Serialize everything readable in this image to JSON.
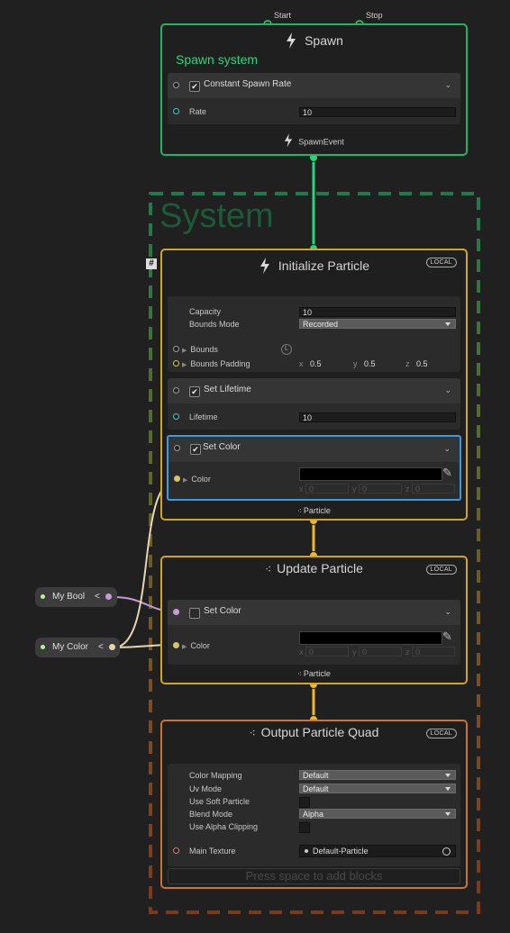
{
  "spawn": {
    "start_label": "Start",
    "stop_label": "Stop",
    "title": "Spawn",
    "subtitle": "Spawn system",
    "block_title": "Constant Spawn Rate",
    "rate_label": "Rate",
    "rate_value": "10",
    "event_label": "SpawnEvent",
    "accent": "#1fb565"
  },
  "system": {
    "title": "System"
  },
  "init": {
    "title": "Initialize Particle",
    "badge": "LOCAL",
    "hash": "#",
    "capacity_label": "Capacity",
    "capacity_value": "10",
    "bounds_mode_label": "Bounds Mode",
    "bounds_mode_value": "Recorded",
    "bounds_label": "Bounds",
    "bounds_badge": "L",
    "bounds_padding_label": "Bounds Padding",
    "padding": {
      "x_label": "x",
      "x": "0.5",
      "y_label": "y",
      "y": "0.5",
      "z_label": "z",
      "z": "0.5"
    },
    "set_lifetime_title": "Set Lifetime",
    "lifetime_label": "Lifetime",
    "lifetime_value": "10",
    "set_color_title": "Set Color",
    "color_label": "Color",
    "color": {
      "x_label": "x",
      "x": "0",
      "y_label": "y",
      "y": "0",
      "z_label": "z",
      "z": "0"
    },
    "flow_label": "Particle"
  },
  "update": {
    "title": "Update Particle",
    "badge": "LOCAL",
    "set_color_title": "Set Color",
    "color_label": "Color",
    "color": {
      "x_label": "x",
      "x": "0",
      "y_label": "y",
      "y": "0",
      "z_label": "z",
      "z": "0"
    },
    "flow_label": "Particle"
  },
  "output": {
    "title": "Output Particle Quad",
    "badge": "LOCAL",
    "color_mapping_label": "Color Mapping",
    "color_mapping_value": "Default",
    "uv_mode_label": "Uv Mode",
    "uv_mode_value": "Default",
    "soft_particle_label": "Use Soft Particle",
    "blend_mode_label": "Blend Mode",
    "blend_mode_value": "Alpha",
    "alpha_clipping_label": "Use Alpha Clipping",
    "main_texture_label": "Main Texture",
    "main_texture_value": "Default-Particle",
    "add_blocks_hint": "Press space to add blocks"
  },
  "properties": [
    {
      "label": "My Bool",
      "chevron": "<"
    },
    {
      "label": "My Color",
      "chevron": "<"
    }
  ],
  "colors": {
    "spawn_border": "#1fb565",
    "init_border": "#d0a526",
    "update_border": "#d0a526",
    "output_border": "#cf7131",
    "selection": "#3a9be0"
  }
}
